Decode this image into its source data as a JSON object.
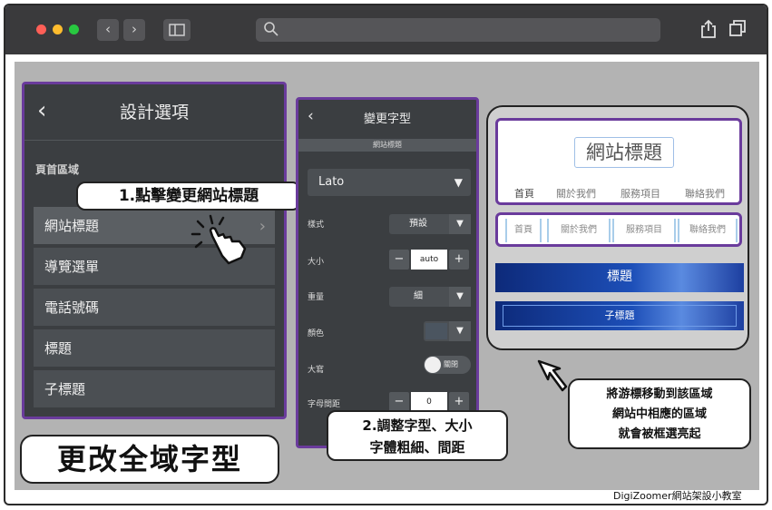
{
  "browser": {
    "traffic_lights": [
      "#ff5f57",
      "#febc2e",
      "#28c840"
    ],
    "back_icon": "chevron-left-icon",
    "forward_icon": "chevron-right-icon",
    "sidebar_icon": "sidebar-icon",
    "search_icon": "search-icon",
    "share_icon": "share-icon",
    "tabs_icon": "tabs-icon",
    "address_value": ""
  },
  "design_panel": {
    "title": "設計選項",
    "section_label": "頁首區域",
    "items": [
      {
        "label": "網站標題",
        "active": true
      },
      {
        "label": "導覽選單",
        "active": false
      },
      {
        "label": "電話號碼",
        "active": false
      },
      {
        "label": "標題",
        "active": false
      },
      {
        "label": "子標題",
        "active": false
      }
    ]
  },
  "font_panel": {
    "title": "變更字型",
    "context_label": "網站標題",
    "font_family": "Lato",
    "style_label": "樣式",
    "style_value": "預設",
    "size_label": "大小",
    "size_value": "auto",
    "weight_label": "重量",
    "weight_value": "細",
    "color_label": "顏色",
    "color_value": "#4b5560",
    "width_label": "大寫",
    "width_toggle_label": "關閉",
    "spacing_label": "字母間距",
    "spacing_value": "0",
    "minus": "−",
    "plus": "+"
  },
  "preview": {
    "site_title": "網站標題",
    "nav": [
      "首頁",
      "關於我們",
      "服務項目",
      "聯絡我們"
    ],
    "heading": "標題",
    "subheading": "子標題"
  },
  "callouts": {
    "step1": "1.點擊變更網站標題",
    "step2_line1": "2.調整字型、大小",
    "step2_line2": "字體粗細、間距",
    "note_line1": "將游標移動到該區域",
    "note_line2": "網站中相應的區域",
    "note_line3": "就會被框選亮起",
    "main_title": "更改全域字型"
  },
  "credit": "DigiZoomer網站架設小教室",
  "colors": {
    "accent_purple": "#6a3b9c",
    "panel_dark": "#3b3e41",
    "stage_gray": "#b3b3b3"
  }
}
